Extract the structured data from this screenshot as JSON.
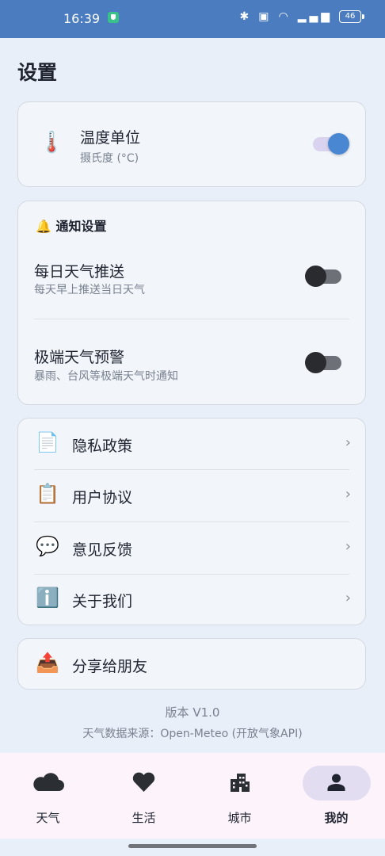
{
  "status": {
    "time": "16:39",
    "battery": "46"
  },
  "page": {
    "title": "设置"
  },
  "unit": {
    "icon": "🌡️",
    "label": "温度单位",
    "value": "摄氏度 (°C)",
    "enabled": true
  },
  "notify": {
    "icon": "🔔",
    "title": "通知设置",
    "items": [
      {
        "label": "每日天气推送",
        "desc": "每天早上推送当日天气",
        "enabled": false
      },
      {
        "label": "极端天气预警",
        "desc": "暴雨、台风等极端天气时通知",
        "enabled": false
      }
    ]
  },
  "links": [
    {
      "icon": "📄",
      "label": "隐私政策",
      "chevron": "›"
    },
    {
      "icon": "📋",
      "label": "用户协议",
      "chevron": "›"
    },
    {
      "icon": "💬",
      "label": "意见反馈",
      "chevron": "›"
    },
    {
      "icon": "ℹ️",
      "label": "关于我们",
      "chevron": "›"
    }
  ],
  "share": {
    "icon": "📤",
    "label": "分享给朋友"
  },
  "footer": {
    "version": "版本 V1.0",
    "source": "天气数据来源：Open-Meteo (开放气象API)"
  },
  "nav": [
    {
      "label": "天气",
      "icon": "cloud-icon"
    },
    {
      "label": "生活",
      "icon": "heart-icon"
    },
    {
      "label": "城市",
      "icon": "city-icon"
    },
    {
      "label": "我的",
      "icon": "person-icon",
      "active": true
    }
  ],
  "colors": {
    "statusbar": "#4a7cbf",
    "accent": "#4a87d2",
    "background": "#e9eff8",
    "nav_active": "#e3ddf2"
  }
}
